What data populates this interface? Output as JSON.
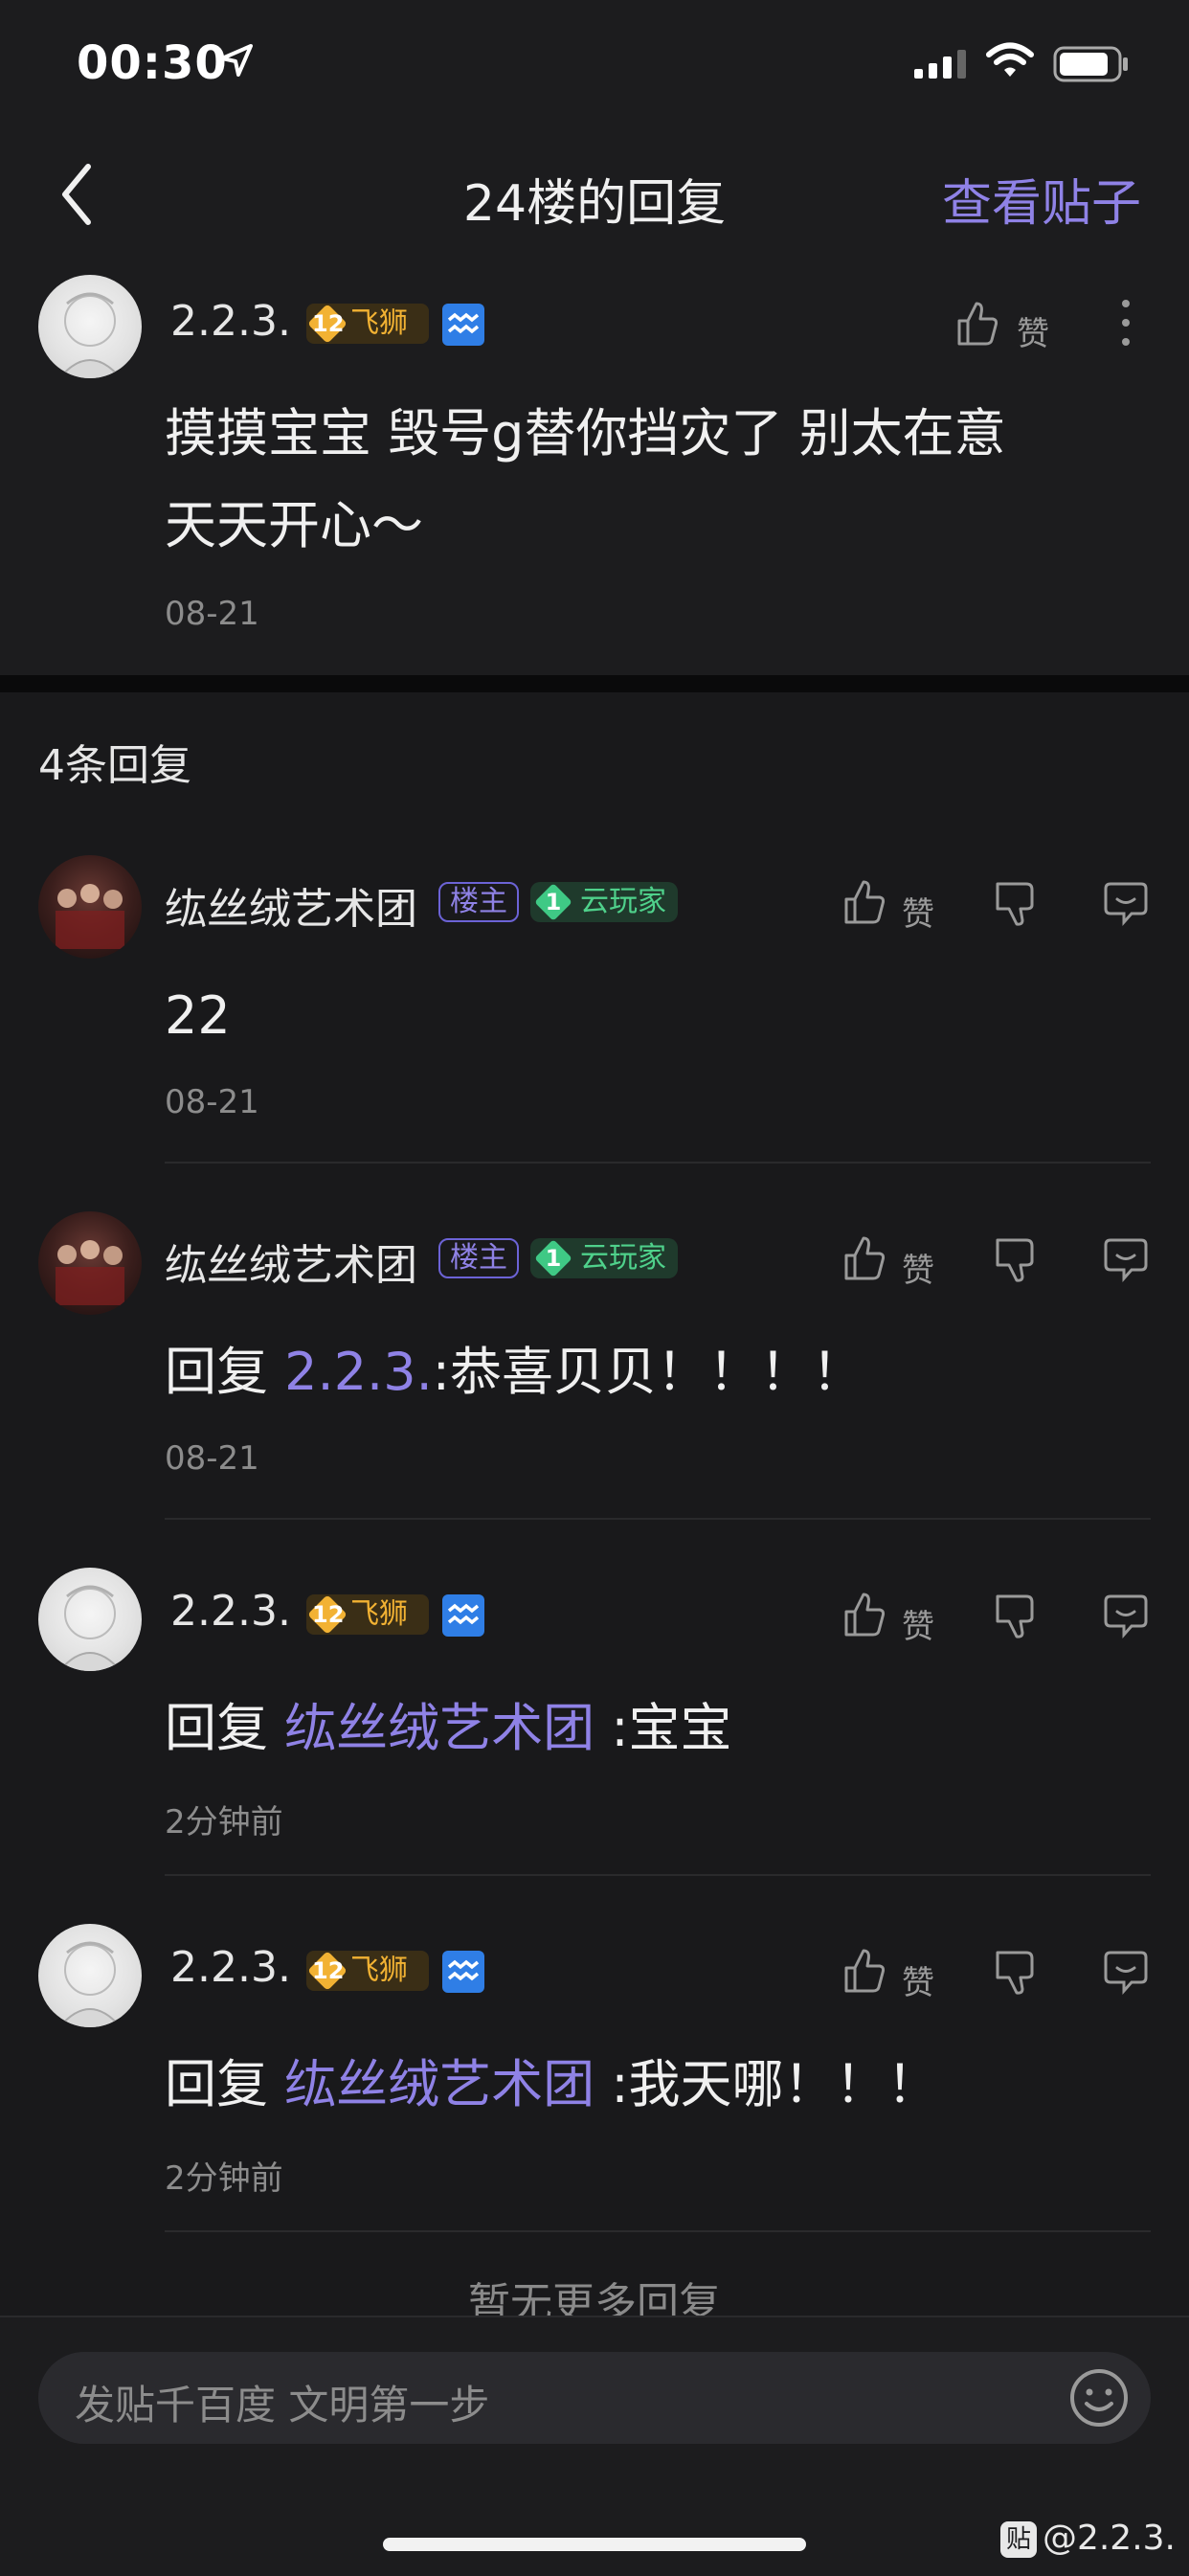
{
  "status_bar": {
    "time": "00:30"
  },
  "nav": {
    "title": "24楼的回复",
    "view_post": "查看贴子"
  },
  "main_post": {
    "username": "2.2.3.",
    "level": "12",
    "level_badge": "飞狮",
    "like_label": "赞",
    "content_line1": "摸摸宝宝 毁号g替你挡灾了 别太在意",
    "content_line2": "天天开心～",
    "date": "08-21"
  },
  "replies_count": "4条回复",
  "replies": [
    {
      "username": "纮丝绒艺术团",
      "owner_badge": "楼主",
      "cloud_level": "1",
      "cloud_badge": "云玩家",
      "like_label": "赞",
      "prefix": "",
      "mention": "",
      "text": "22",
      "date": "08-21"
    },
    {
      "username": "纮丝绒艺术团",
      "owner_badge": "楼主",
      "cloud_level": "1",
      "cloud_badge": "云玩家",
      "like_label": "赞",
      "prefix": "回复 ",
      "mention": "2.2.3.",
      "text": ":恭喜贝贝！！！！",
      "date": "08-21"
    },
    {
      "username": "2.2.3.",
      "level": "12",
      "level_badge": "飞狮",
      "like_label": "赞",
      "prefix": "回复 ",
      "mention": "纮丝绒艺术团",
      "text": " :宝宝",
      "date": "2分钟前"
    },
    {
      "username": "2.2.3.",
      "level": "12",
      "level_badge": "飞狮",
      "like_label": "赞",
      "prefix": "回复 ",
      "mention": "纮丝绒艺术团",
      "text": " :我天哪！！！",
      "date": "2分钟前"
    }
  ],
  "no_more": "暂无更多回复",
  "comment_bar": {
    "placeholder": "发贴千百度 文明第一步"
  },
  "watermark": {
    "icon": "贴",
    "text": "@2.2.3."
  },
  "colors": {
    "accent": "#8f82e6",
    "background": "#1c1c1e",
    "level_gold": "#f2b233",
    "cloud_green": "#4fd18b"
  }
}
